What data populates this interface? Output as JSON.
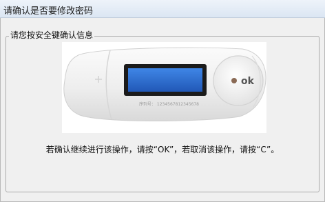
{
  "window": {
    "title": "请确认是否要修改密码"
  },
  "group": {
    "legend": "请您按安全键确认信息"
  },
  "device": {
    "ok_label": "ok",
    "serial_text": "序列号： 1234567812345678",
    "screen_color": "#2f6fd0"
  },
  "message": {
    "instruction": "若确认继续进行该操作，请按“OK”，若取消该操作，请按“C”。"
  }
}
